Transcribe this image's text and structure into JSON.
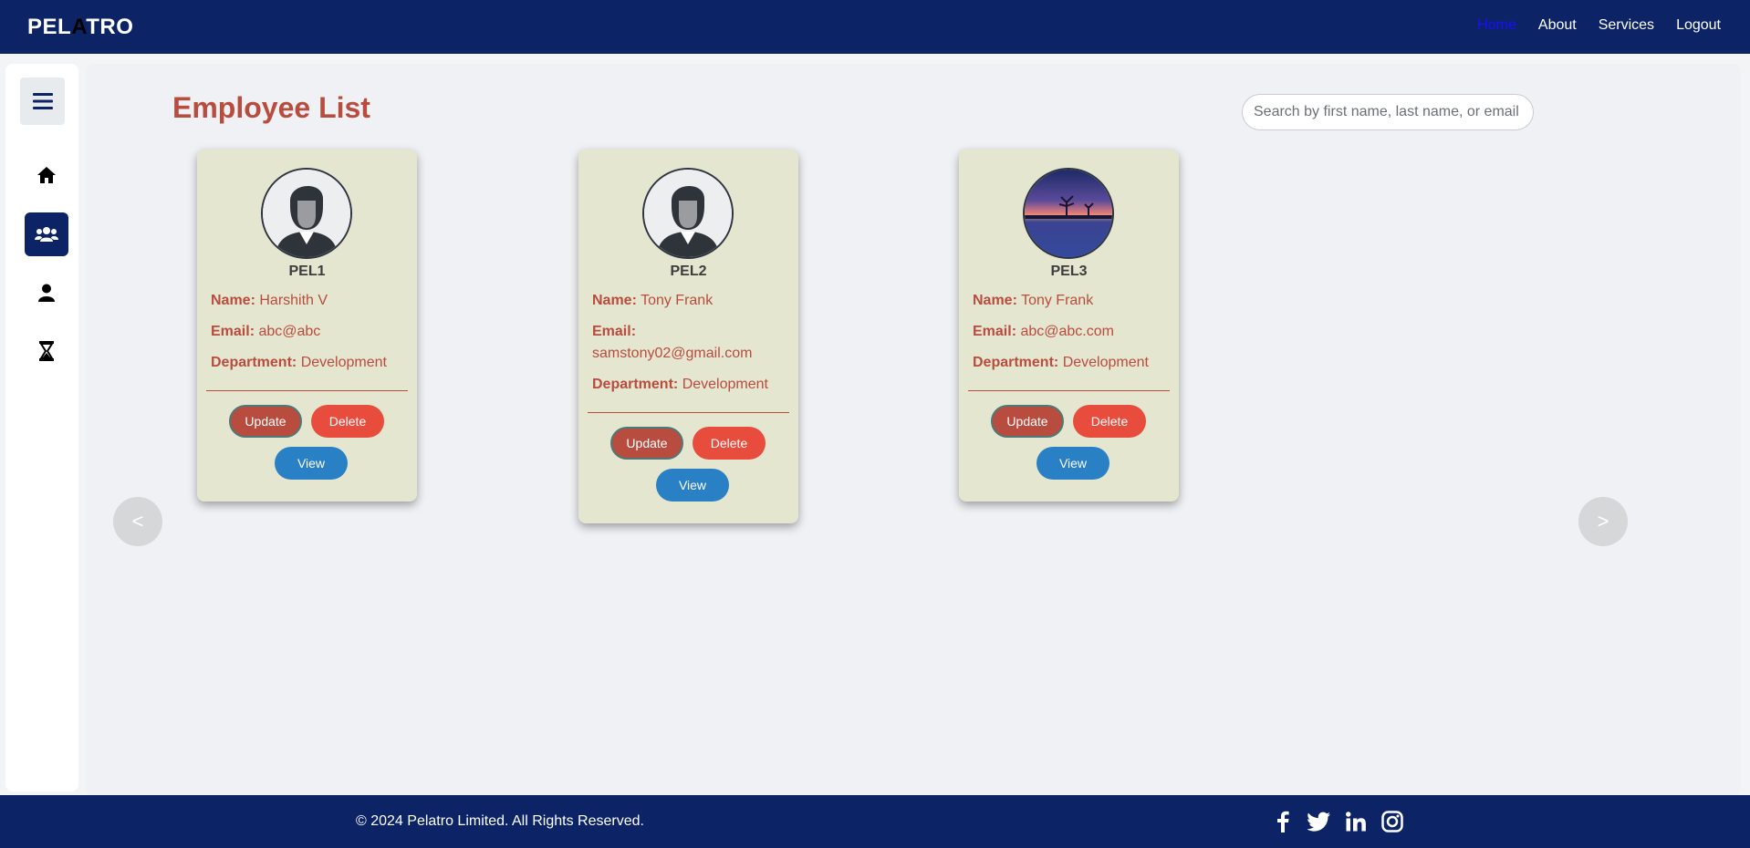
{
  "header": {
    "brand": {
      "part1": "PEL",
      "part2": "A",
      "part3": "TRO"
    },
    "nav": [
      {
        "label": "Home",
        "active": true
      },
      {
        "label": "About",
        "active": false
      },
      {
        "label": "Services",
        "active": false
      },
      {
        "label": "Logout",
        "active": false
      }
    ]
  },
  "sidebar": {
    "items": [
      {
        "icon": "home-icon"
      },
      {
        "icon": "users-icon",
        "active": true
      },
      {
        "icon": "user-icon"
      },
      {
        "icon": "hourglass-icon"
      }
    ]
  },
  "main": {
    "title": "Employee List",
    "search_placeholder": "Search by first name, last name, or email",
    "labels": {
      "name": "Name:",
      "email": "Email:",
      "department": "Department:"
    },
    "buttons": {
      "update": "Update",
      "delete": "Delete",
      "view": "View"
    },
    "employees": [
      {
        "id": "PEL1",
        "name": "Harshith V",
        "email": "abc@abc",
        "department": "Development",
        "avatar": "default-avatar"
      },
      {
        "id": "PEL2",
        "name": "Tony Frank",
        "email": "samstony02@gmail.com",
        "department": "Development",
        "avatar": "default-avatar"
      },
      {
        "id": "PEL3",
        "name": "Tony Frank",
        "email": "abc@abc.com",
        "department": "Development",
        "avatar": "landscape-photo"
      }
    ],
    "pager": {
      "prev": "<",
      "next": ">"
    }
  },
  "footer": {
    "copyright": "© 2024 Pelatro Limited. All Rights Reserved.",
    "socials": [
      "facebook-icon",
      "twitter-icon",
      "linkedin-icon",
      "instagram-icon"
    ]
  },
  "colors": {
    "navbar": "#0c2466",
    "accent": "#b84c3e",
    "card": "#e5e6d0",
    "delete": "#e74c3c",
    "view": "#2980c4"
  }
}
